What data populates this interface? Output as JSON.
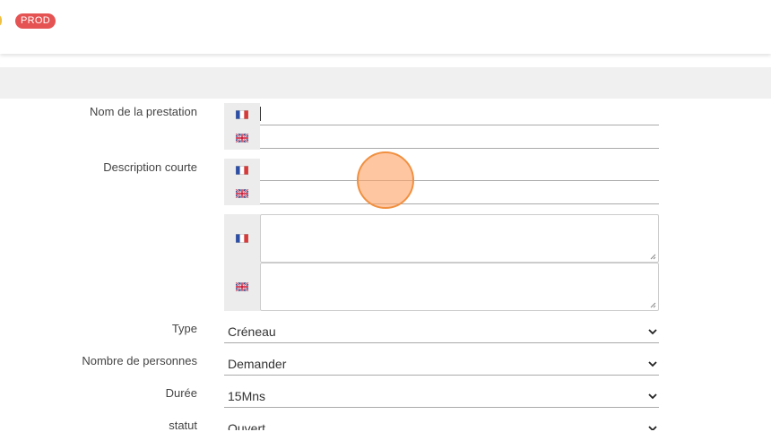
{
  "header": {
    "env_badge": "PROD"
  },
  "form": {
    "name_label": "Nom de la prestation",
    "short_desc_label": "Description courte",
    "name_fr_value": "",
    "name_en_value": "",
    "short_desc_fr_value": "",
    "short_desc_en_value": "",
    "long_desc_fr_value": "",
    "long_desc_en_value": "",
    "type_label": "Type",
    "type_value": "Créneau",
    "persons_label": "Nombre de personnes",
    "persons_value": "Demander",
    "duration_label": "Durée",
    "duration_value": "15Mns",
    "status_label": "statut",
    "status_value": "Ouvert"
  },
  "icons": {
    "fr": "flag-fr-icon",
    "en": "flag-uk-icon",
    "select": "chevron-down-icon"
  },
  "colors": {
    "badge": "#e55353",
    "flag_bg": "#ececec",
    "cursor_fill": "#ffa064",
    "cursor_border": "#f09040"
  }
}
